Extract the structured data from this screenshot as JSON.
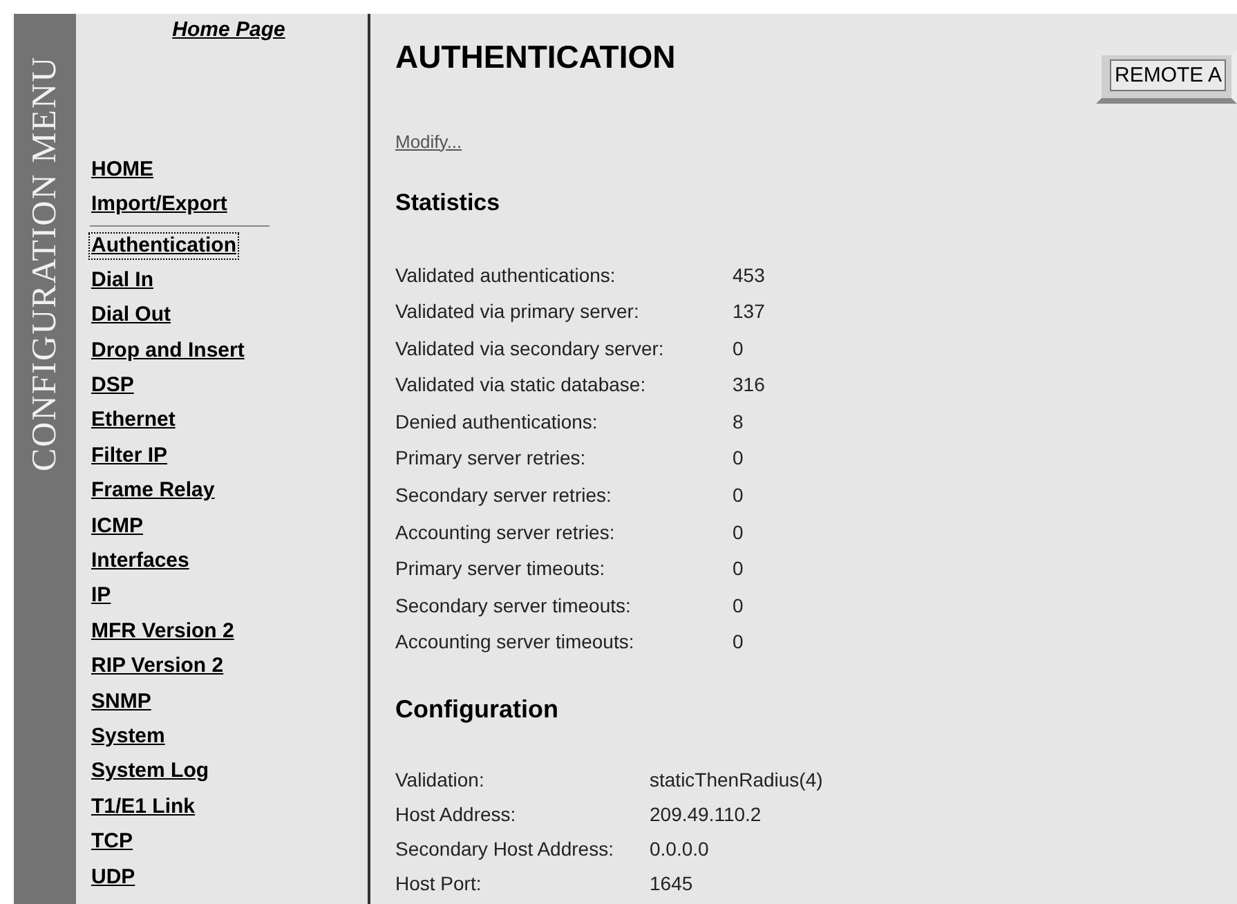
{
  "sidebar_banner": "CONFIGURATION MENU",
  "home_link": "Home Page",
  "top_links": [
    {
      "label": "HOME",
      "selected": false
    },
    {
      "label": "Import/Export",
      "selected": false
    }
  ],
  "menu": [
    {
      "label": "Authentication",
      "selected": true
    },
    {
      "label": "Dial In",
      "selected": false
    },
    {
      "label": "Dial Out",
      "selected": false
    },
    {
      "label": "Drop and Insert",
      "selected": false
    },
    {
      "label": "DSP",
      "selected": false
    },
    {
      "label": "Ethernet",
      "selected": false
    },
    {
      "label": "Filter IP",
      "selected": false
    },
    {
      "label": "Frame Relay",
      "selected": false
    },
    {
      "label": "ICMP",
      "selected": false
    },
    {
      "label": "Interfaces",
      "selected": false
    },
    {
      "label": "IP",
      "selected": false
    },
    {
      "label": "MFR Version 2",
      "selected": false
    },
    {
      "label": "RIP Version 2",
      "selected": false
    },
    {
      "label": "SNMP",
      "selected": false
    },
    {
      "label": "System",
      "selected": false
    },
    {
      "label": "System Log",
      "selected": false
    },
    {
      "label": "T1/E1 Link",
      "selected": false
    },
    {
      "label": "TCP",
      "selected": false
    },
    {
      "label": "UDP",
      "selected": false
    }
  ],
  "title": "AUTHENTICATION",
  "remote_button": "REMOTE A",
  "modify_link": "Modify...",
  "statistics": {
    "heading": "Statistics",
    "rows": [
      {
        "label": "Validated authentications:",
        "value": "453"
      },
      {
        "label": "Validated via primary server:",
        "value": "137"
      },
      {
        "label": "Validated via secondary server:",
        "value": "0"
      },
      {
        "label": "Validated via static database:",
        "value": "316"
      },
      {
        "label": "Denied authentications:",
        "value": "8"
      },
      {
        "label": "Primary server retries:",
        "value": "0"
      },
      {
        "label": "Secondary server retries:",
        "value": "0"
      },
      {
        "label": "Accounting server retries:",
        "value": "0"
      },
      {
        "label": "Primary server timeouts:",
        "value": "0"
      },
      {
        "label": "Secondary server timeouts:",
        "value": "0"
      },
      {
        "label": "Accounting server timeouts:",
        "value": "0"
      }
    ]
  },
  "configuration": {
    "heading": "Configuration",
    "rows": [
      {
        "label": "Validation:",
        "value": "staticThenRadius(4)"
      },
      {
        "label": "Host Address:",
        "value": "209.49.110.2"
      },
      {
        "label": "Secondary Host Address:",
        "value": "0.0.0.0"
      },
      {
        "label": "Host Port:",
        "value": "1645"
      }
    ]
  }
}
